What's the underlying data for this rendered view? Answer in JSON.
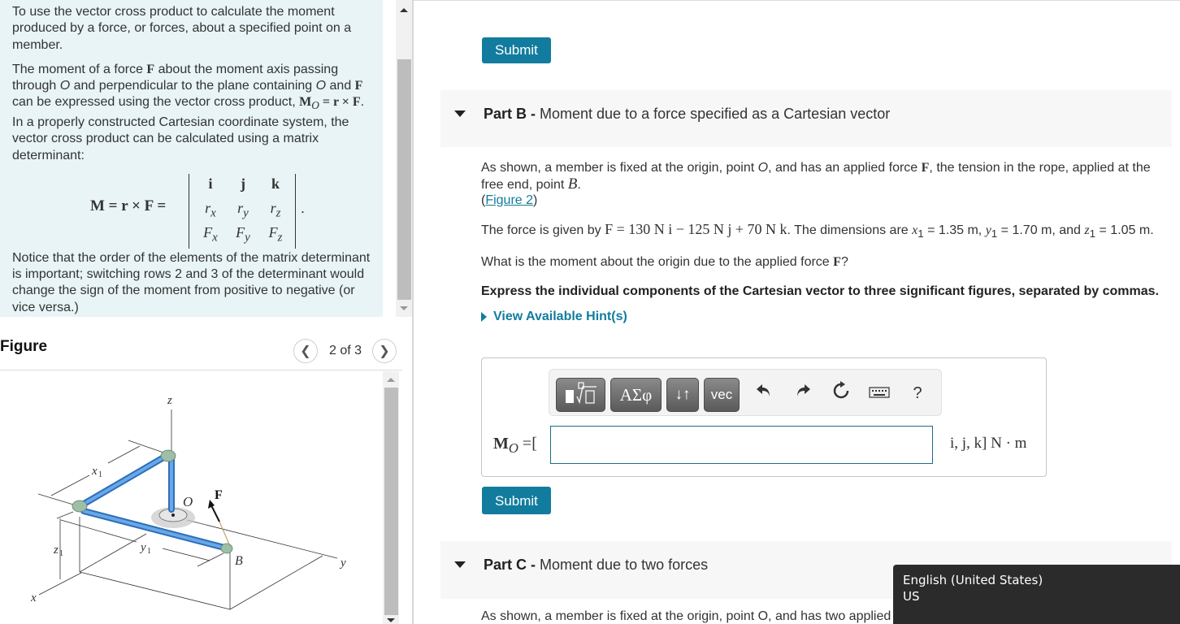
{
  "intro": {
    "para1": "To use the vector cross product to calculate the moment produced by a force, or forces, about a specified point on a member.",
    "para2_a": "The moment of a force ",
    "para2_F": "F",
    "para2_b": " about the moment axis passing through ",
    "para2_O1": "O",
    "para2_c": " and perpendicular to the plane containing ",
    "para2_O2": "O",
    "para2_d": " and ",
    "para2_F2": "F",
    "para2_e": " can be expressed using the vector cross product, ",
    "para2_eq_M": "M",
    "para2_eq_sub": "O",
    "para2_eq_rest": " = r × F",
    "para2_f": ". In a properly constructed Cartesian coordinate system, the vector cross product can be calculated using a matrix determinant:",
    "formula": {
      "lhs": "M = r × F =",
      "rows": [
        [
          "i",
          "j",
          "k"
        ],
        [
          "r",
          "r",
          "r"
        ],
        [
          "F",
          "F",
          "F"
        ]
      ],
      "subscripts": [
        "x",
        "y",
        "z"
      ],
      "trailing": "."
    },
    "para3": "Notice that the order of the elements of the matrix determinant is important; switching rows 2 and 3 of the determinant would change the sign of the moment from positive to negative (or vice versa.)"
  },
  "figure": {
    "title": "Figure",
    "counter": "2 of 3",
    "prev_icon": "chevron-left-icon",
    "next_icon": "chevron-right-icon",
    "labels": {
      "z": "z",
      "x_axis": "x",
      "y_axis": "y",
      "x1": "x",
      "y1": "y",
      "z1": "z",
      "sub1": "1",
      "O": "O",
      "F": "F",
      "B": "B"
    },
    "pipe_color": "#4a8fd6",
    "joint_color": "#8fb8a0"
  },
  "top_submit": {
    "label": "Submit"
  },
  "partB": {
    "prefix": "Part B - ",
    "title": "Moment due to a force specified as a Cartesian vector",
    "body1_a": "As shown, a member is fixed at the origin, point ",
    "body1_O": "O",
    "body1_b": ", and has an applied force ",
    "body1_F": "F",
    "body1_c": ", the tension in the rope, applied at the free end, point ",
    "body1_B": "B",
    "body1_d": ".",
    "figure_link": "Figure 2",
    "body2_a": "The force is given by ",
    "body2_eq": "F = 130 N i − 125 N j + 70 N k",
    "body2_b": ". The dimensions are ",
    "x1_label": "x",
    "x1_value": " = 1.35 m, ",
    "y1_label": "y",
    "y1_value": " = 1.70 m, and ",
    "z1_label": "z",
    "z1_value": " = 1.05 m.",
    "sub1": "1",
    "question_a": "What is the moment about the origin due to the applied force ",
    "question_F": "F",
    "question_b": "?",
    "instruction": "Express the individual components of the Cartesian vector to three significant figures, separated by commas.",
    "hint_label": "View Available Hint(s)",
    "toolbar": {
      "templates_label": "templates",
      "greek_label": "ΑΣφ",
      "arrows_label": "↓↑",
      "vec_label": "vec",
      "undo": "↶",
      "redo": "↷",
      "reset": "↻",
      "help": "?"
    },
    "answer_label_M": "M",
    "answer_label_sub": "O",
    "answer_label_rest": " =[",
    "answer_value": "",
    "answer_units": "i, j, k] N · m",
    "submit_label": "Submit"
  },
  "partC": {
    "prefix": "Part C - ",
    "title": "Moment due to two forces",
    "body_visible": "As shown, a member is fixed at the origin, point O, and has two applied"
  },
  "tooltip": {
    "line1": "English (United States)",
    "line2": "US"
  },
  "colors": {
    "accent": "#127c9e",
    "intro_bg": "#e8f4f6",
    "part_header_bg": "#f7f7f7",
    "tooltip_bg": "#2b2b2b"
  }
}
